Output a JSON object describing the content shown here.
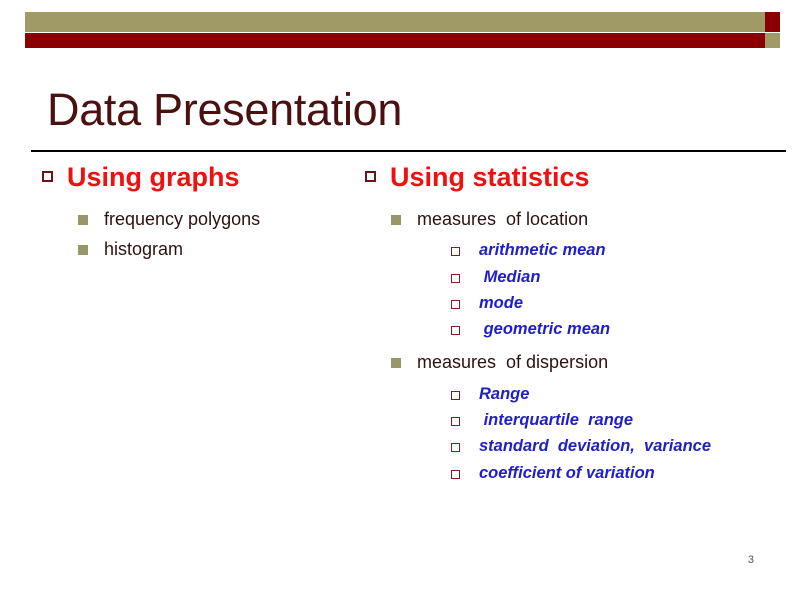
{
  "slide": {
    "title": "Data Presentation",
    "page_number": "3"
  },
  "theme": {
    "olive": "#a09a66",
    "maroon": "#8a0000",
    "title_color": "#4b1111",
    "heading_red": "#f01010",
    "level2_color": "#2e1111",
    "level3_blue": "#1f1fc8",
    "rule_color": "#000000",
    "background": "#ffffff"
  },
  "columns": {
    "left": {
      "heading": "Using graphs",
      "items": [
        {
          "label": "frequency polygons",
          "children": []
        },
        {
          "label": "histogram",
          "children": []
        }
      ]
    },
    "right": {
      "heading": "Using statistics",
      "items": [
        {
          "label": "measures  of location",
          "children": [
            "arithmetic mean",
            " Median",
            "mode",
            " geometric mean"
          ]
        },
        {
          "label": "measures  of dispersion",
          "children": [
            "Range",
            " interquartile  range",
            "standard  deviation,  variance",
            "coefficient of variation"
          ]
        }
      ]
    }
  }
}
